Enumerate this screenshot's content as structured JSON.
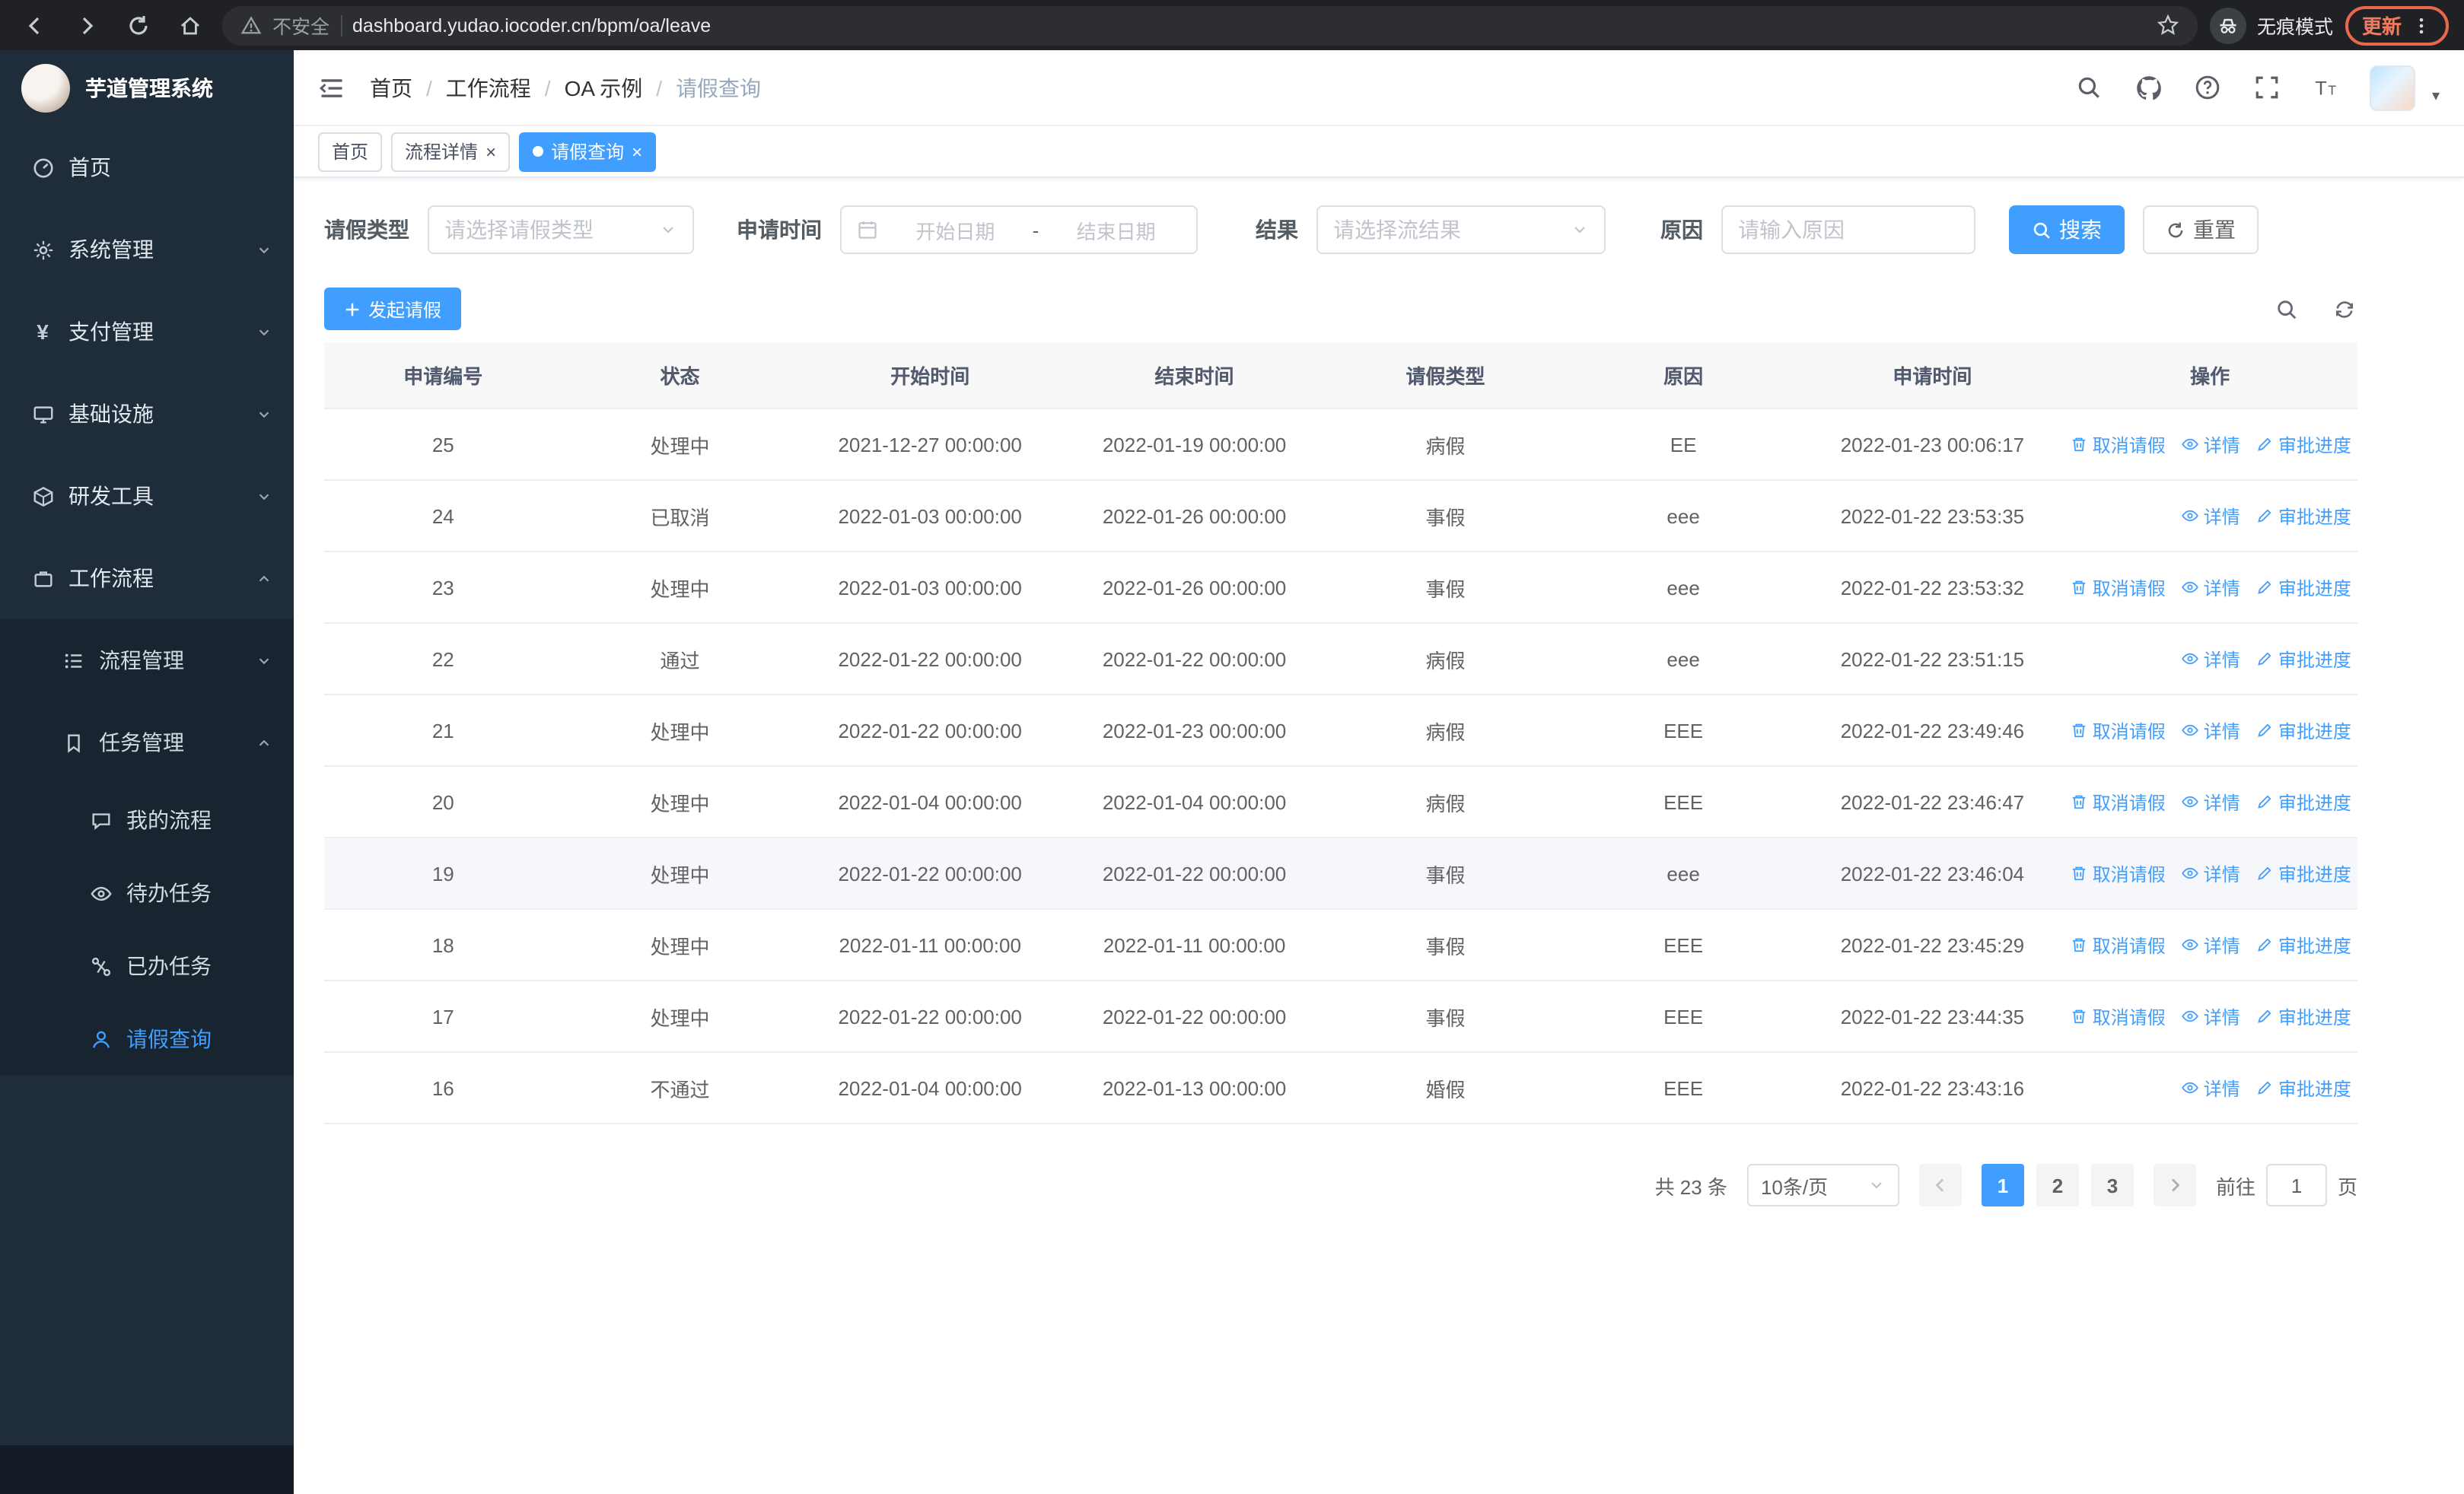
{
  "browser": {
    "security_label": "不安全",
    "url": "dashboard.yudao.iocoder.cn/bpm/oa/leave",
    "incognito_label": "无痕模式",
    "update_label": "更新"
  },
  "sidebar": {
    "logo_title": "芋道管理系统",
    "items": [
      {
        "label": "首页"
      },
      {
        "label": "系统管理"
      },
      {
        "label": "支付管理"
      },
      {
        "label": "基础设施"
      },
      {
        "label": "研发工具"
      },
      {
        "label": "工作流程"
      }
    ],
    "workflow_children": [
      {
        "label": "流程管理"
      },
      {
        "label": "任务管理"
      }
    ],
    "task_children": [
      {
        "label": "我的流程"
      },
      {
        "label": "待办任务"
      },
      {
        "label": "已办任务"
      },
      {
        "label": "请假查询"
      }
    ]
  },
  "header": {
    "breadcrumb": [
      "首页",
      "工作流程",
      "OA 示例",
      "请假查询"
    ],
    "separator": "/"
  },
  "tabs": [
    {
      "label": "首页"
    },
    {
      "label": "流程详情"
    },
    {
      "label": "请假查询"
    }
  ],
  "filters": {
    "leave_type_label": "请假类型",
    "leave_type_placeholder": "请选择请假类型",
    "apply_time_label": "申请时间",
    "start_placeholder": "开始日期",
    "separator": "-",
    "end_placeholder": "结束日期",
    "result_label": "结果",
    "result_placeholder": "请选择流结果",
    "reason_label": "原因",
    "reason_placeholder": "请输入原因",
    "search_button": "搜索",
    "reset_button": "重置"
  },
  "toolbar": {
    "create_button": "发起请假"
  },
  "table": {
    "columns": [
      "申请编号",
      "状态",
      "开始时间",
      "结束时间",
      "请假类型",
      "原因",
      "申请时间",
      "操作"
    ],
    "action_labels": {
      "cancel": "取消请假",
      "detail": "详情",
      "progress": "审批进度"
    },
    "rows": [
      {
        "id": "25",
        "status": "处理中",
        "start": "2021-12-27 00:00:00",
        "end": "2022-01-19 00:00:00",
        "type": "病假",
        "reason": "EE",
        "applied": "2022-01-23 00:06:17",
        "actions": [
          "cancel",
          "detail",
          "progress"
        ],
        "highlighted": false
      },
      {
        "id": "24",
        "status": "已取消",
        "start": "2022-01-03 00:00:00",
        "end": "2022-01-26 00:00:00",
        "type": "事假",
        "reason": "eee",
        "applied": "2022-01-22 23:53:35",
        "actions": [
          "detail",
          "progress"
        ],
        "highlighted": false
      },
      {
        "id": "23",
        "status": "处理中",
        "start": "2022-01-03 00:00:00",
        "end": "2022-01-26 00:00:00",
        "type": "事假",
        "reason": "eee",
        "applied": "2022-01-22 23:53:32",
        "actions": [
          "cancel",
          "detail",
          "progress"
        ],
        "highlighted": false
      },
      {
        "id": "22",
        "status": "通过",
        "start": "2022-01-22 00:00:00",
        "end": "2022-01-22 00:00:00",
        "type": "病假",
        "reason": "eee",
        "applied": "2022-01-22 23:51:15",
        "actions": [
          "detail",
          "progress"
        ],
        "highlighted": false
      },
      {
        "id": "21",
        "status": "处理中",
        "start": "2022-01-22 00:00:00",
        "end": "2022-01-23 00:00:00",
        "type": "病假",
        "reason": "EEE",
        "applied": "2022-01-22 23:49:46",
        "actions": [
          "cancel",
          "detail",
          "progress"
        ],
        "highlighted": false
      },
      {
        "id": "20",
        "status": "处理中",
        "start": "2022-01-04 00:00:00",
        "end": "2022-01-04 00:00:00",
        "type": "病假",
        "reason": "EEE",
        "applied": "2022-01-22 23:46:47",
        "actions": [
          "cancel",
          "detail",
          "progress"
        ],
        "highlighted": false
      },
      {
        "id": "19",
        "status": "处理中",
        "start": "2022-01-22 00:00:00",
        "end": "2022-01-22 00:00:00",
        "type": "事假",
        "reason": "eee",
        "applied": "2022-01-22 23:46:04",
        "actions": [
          "cancel",
          "detail",
          "progress"
        ],
        "highlighted": true
      },
      {
        "id": "18",
        "status": "处理中",
        "start": "2022-01-11 00:00:00",
        "end": "2022-01-11 00:00:00",
        "type": "事假",
        "reason": "EEE",
        "applied": "2022-01-22 23:45:29",
        "actions": [
          "cancel",
          "detail",
          "progress"
        ],
        "highlighted": false
      },
      {
        "id": "17",
        "status": "处理中",
        "start": "2022-01-22 00:00:00",
        "end": "2022-01-22 00:00:00",
        "type": "事假",
        "reason": "EEE",
        "applied": "2022-01-22 23:44:35",
        "actions": [
          "cancel",
          "detail",
          "progress"
        ],
        "highlighted": false
      },
      {
        "id": "16",
        "status": "不通过",
        "start": "2022-01-04 00:00:00",
        "end": "2022-01-13 00:00:00",
        "type": "婚假",
        "reason": "EEE",
        "applied": "2022-01-22 23:43:16",
        "actions": [
          "detail",
          "progress"
        ],
        "highlighted": false
      }
    ]
  },
  "pagination": {
    "total": "共 23 条",
    "page_size": "10条/页",
    "pages": [
      "1",
      "2",
      "3"
    ],
    "goto_label": "前往",
    "goto_value": "1",
    "unit_label": "页"
  },
  "colors": {
    "accent": "#409eff",
    "sidebar_bg": "#1f2c39",
    "submenu_bg": "#182430"
  }
}
